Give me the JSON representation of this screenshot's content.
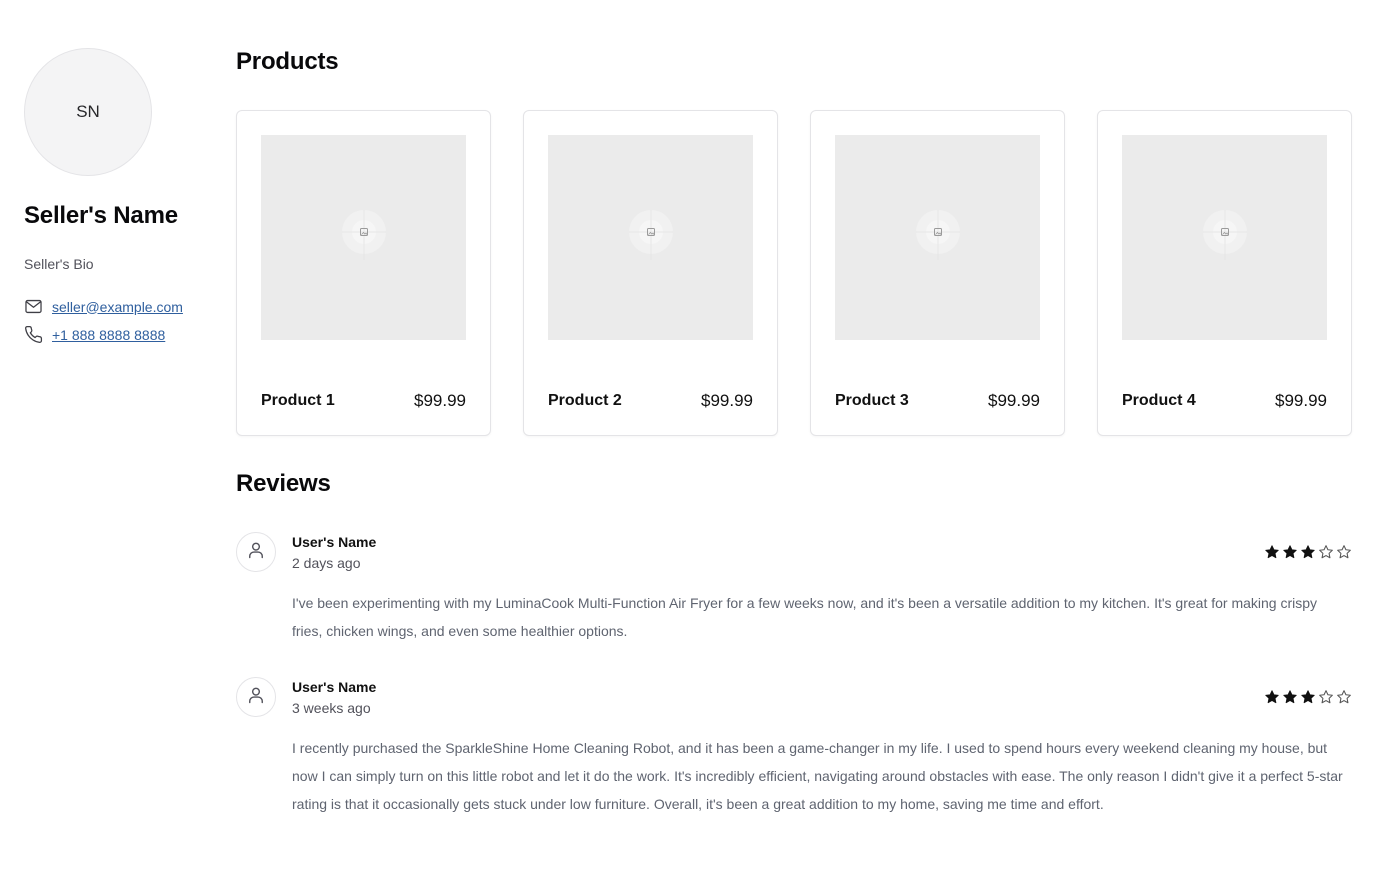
{
  "seller": {
    "initials": "SN",
    "name": "Seller's Name",
    "bio": "Seller's Bio",
    "email": "seller@example.com",
    "phone": "+1 888 8888 8888"
  },
  "products_section": {
    "title": "Products",
    "items": [
      {
        "name": "Product 1",
        "price": "$99.99"
      },
      {
        "name": "Product 2",
        "price": "$99.99"
      },
      {
        "name": "Product 3",
        "price": "$99.99"
      },
      {
        "name": "Product 4",
        "price": "$99.99"
      }
    ]
  },
  "reviews_section": {
    "title": "Reviews",
    "items": [
      {
        "user": "User's Name",
        "time": "2 days ago",
        "rating": 3,
        "max_rating": 5,
        "text": "I've been experimenting with my LuminaCook Multi-Function Air Fryer for a few weeks now, and it's been a versatile addition to my kitchen. It's great for making crispy fries, chicken wings, and even some healthier options."
      },
      {
        "user": "User's Name",
        "time": "3 weeks ago",
        "rating": 3,
        "max_rating": 5,
        "text": "I recently purchased the SparkleShine Home Cleaning Robot, and it has been a game-changer in my life. I used to spend hours every weekend cleaning my house, but now I can simply turn on this little robot and let it do the work. It's incredibly efficient, navigating around obstacles with ease. The only reason I didn't give it a perfect 5-star rating is that it occasionally gets stuck under low furniture. Overall, it's been a great addition to my home, saving me time and effort."
      }
    ]
  },
  "icons": {
    "email": "mail-icon",
    "phone": "phone-icon",
    "user": "user-icon",
    "image_placeholder": "image-placeholder-icon",
    "star_filled": "star-filled-icon",
    "star_empty": "star-outline-icon"
  },
  "colors": {
    "link": "#2f5f9e",
    "placeholder_bg": "#ebebeb",
    "border": "#e4e4e7",
    "muted_text": "#5f6470"
  }
}
